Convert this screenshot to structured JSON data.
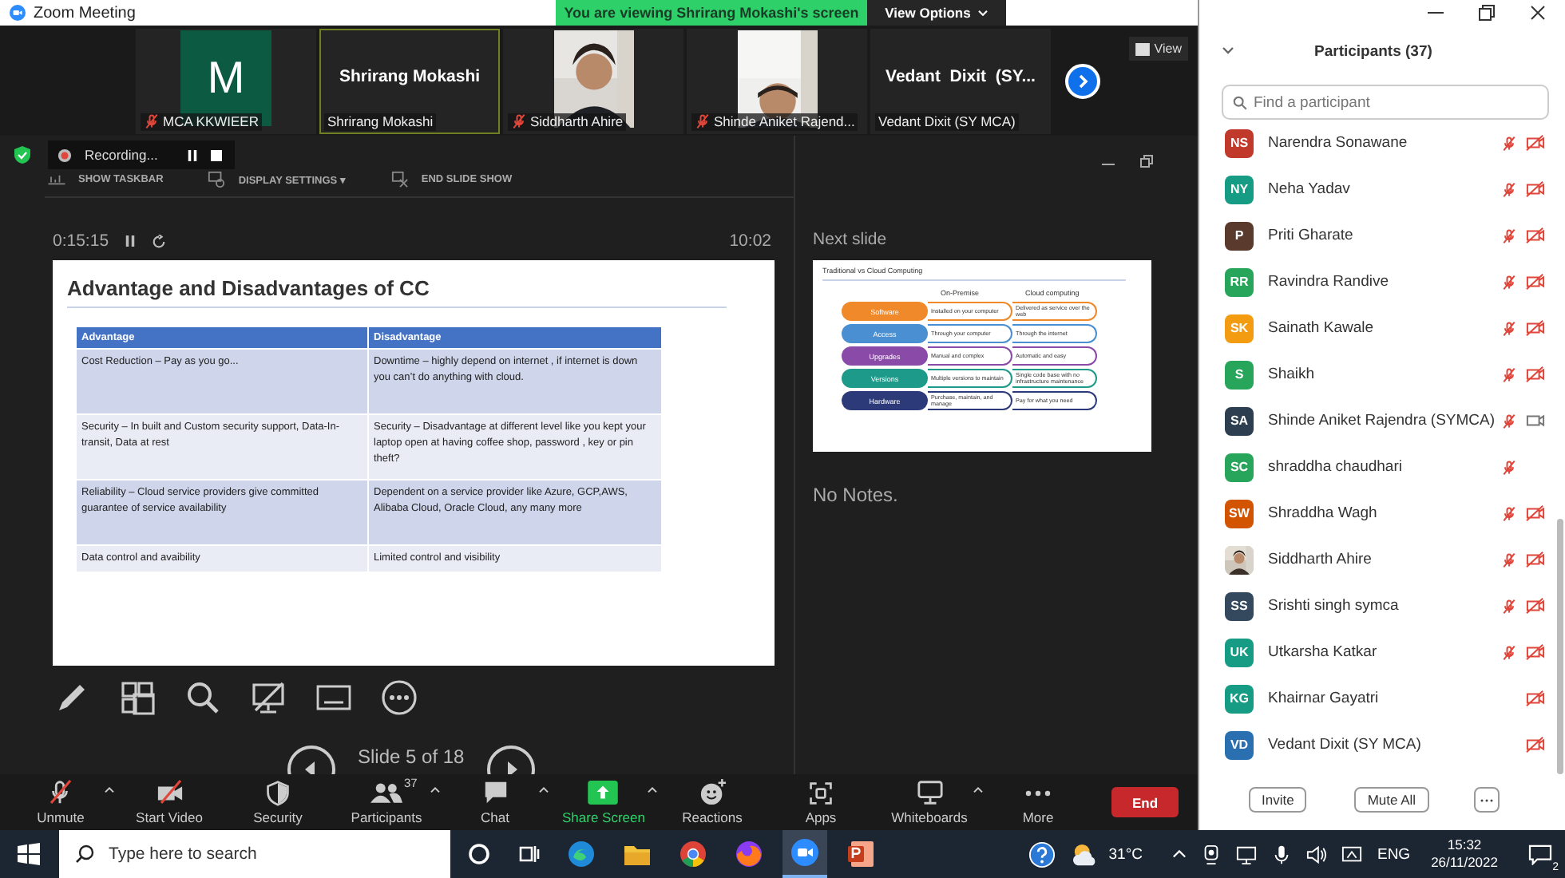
{
  "window": {
    "title": "Zoom Meeting"
  },
  "share_banner": {
    "text": "You are viewing Shrirang Mokashi's screen",
    "options": "View Options"
  },
  "gallery": {
    "tiles": [
      {
        "kind": "initial",
        "letter": "M",
        "name": "MCA KKWIEER",
        "muted": true,
        "selected": false
      },
      {
        "kind": "name",
        "title": "Shrirang Mokashi",
        "name": "Shrirang Mokashi",
        "muted": false,
        "selected": true
      },
      {
        "kind": "picture",
        "name": "Siddharth Ahire",
        "muted": true,
        "selected": false
      },
      {
        "kind": "picture",
        "name": "Shinde Aniket Rajend...",
        "muted": true,
        "selected": false
      },
      {
        "kind": "name",
        "title": "Vedant  Dixit  (SY...",
        "name": "Vedant Dixit (SY MCA)",
        "muted": false,
        "selected": false
      }
    ],
    "view_label": "View"
  },
  "presenter": {
    "recording": "Recording...",
    "menu": [
      "SHOW TASKBAR",
      "DISPLAY SETTINGS ▾",
      "END SLIDE SHOW"
    ],
    "elapsed": "0:15:15",
    "clock": "10:02",
    "slide": {
      "title": "Advantage and Disadvantages of CC",
      "columns": [
        "Advantage",
        "Disadvantage"
      ],
      "rows": [
        [
          "Cost Reduction – Pay as you go...",
          "Downtime – highly depend on internet , if internet is down you can’t do anything with cloud."
        ],
        [
          "Security – In built and Custom security support, Data-In-transit, Data at rest",
          "Security – Disadvantage at different level like you kept your laptop open at having coffee shop, password , key or pin theft?"
        ],
        [
          "Reliability – Cloud service providers give committed guarantee of service availability",
          "Dependent on a service provider like Azure, GCP,AWS, Alibaba Cloud, Oracle Cloud, any many more"
        ],
        [
          "Data control and avaibility",
          "Limited control and visibility"
        ]
      ]
    },
    "next_label": "Next slide",
    "next_slide": {
      "title": "Traditional vs Cloud Computing",
      "columns": [
        "On-Premise",
        "Cloud computing"
      ],
      "rows": [
        {
          "label": "Software",
          "color": "#f0892a",
          "on_premise": "Installed on your computer",
          "cloud": "Delivered as service over the web"
        },
        {
          "label": "Access",
          "color": "#4a8fd1",
          "on_premise": "Through your computer",
          "cloud": "Through the internet"
        },
        {
          "label": "Upgrades",
          "color": "#8a4aa8",
          "on_premise": "Manual and complex",
          "cloud": "Automatic and easy"
        },
        {
          "label": "Versions",
          "color": "#1e9a8a",
          "on_premise": "Multiple versions to maintain",
          "cloud": "Single code base with no infrastructure maintenance"
        },
        {
          "label": "Hardware",
          "color": "#2c3a7a",
          "on_premise": "Purchase, maintain, and manage",
          "cloud": "Pay for what you need"
        }
      ]
    },
    "notes": "No Notes.",
    "slide_counter": "Slide 5 of 18"
  },
  "toolbar": {
    "buttons": [
      {
        "kind": "mic",
        "label": "Unmute",
        "caret": true,
        "slashed": true
      },
      {
        "kind": "video",
        "label": "Start Video",
        "caret": false,
        "slashed": true
      },
      {
        "kind": "security",
        "label": "Security",
        "caret": false,
        "slashed": false
      },
      {
        "kind": "participants",
        "label": "Participants",
        "badge": "37",
        "caret": true,
        "slashed": false
      },
      {
        "kind": "chat",
        "label": "Chat",
        "caret": true,
        "slashed": false
      },
      {
        "kind": "share",
        "label": "Share Screen",
        "caret": true,
        "slashed": false
      },
      {
        "kind": "reactions",
        "label": "Reactions",
        "caret": false,
        "slashed": false
      },
      {
        "kind": "apps",
        "label": "Apps",
        "caret": false,
        "slashed": false
      },
      {
        "kind": "whiteboards",
        "label": "Whiteboards",
        "caret": true,
        "slashed": false
      },
      {
        "kind": "more",
        "label": "More",
        "caret": false,
        "slashed": false
      }
    ],
    "end": "End"
  },
  "participants": {
    "title": "Participants (37)",
    "placeholder": "Find a participant",
    "list": [
      {
        "kind": "initials",
        "initials": "NS",
        "color": "#c0392b",
        "name": "Narendra Sonawane",
        "muted": true,
        "video_off": true,
        "video_on": false
      },
      {
        "kind": "initials",
        "initials": "NY",
        "color": "#169c84",
        "name": "Neha Yadav",
        "muted": true,
        "video_off": true,
        "video_on": false
      },
      {
        "kind": "initials",
        "initials": "P",
        "color": "#5a3a2c",
        "name": "Priti Gharate",
        "muted": true,
        "video_off": true,
        "video_on": false
      },
      {
        "kind": "initials",
        "initials": "RR",
        "color": "#27a55a",
        "name": "Ravindra Randive",
        "muted": true,
        "video_off": true,
        "video_on": false
      },
      {
        "kind": "initials",
        "initials": "SK",
        "color": "#f39c12",
        "name": "Sainath Kawale",
        "muted": true,
        "video_off": true,
        "video_on": false
      },
      {
        "kind": "initials",
        "initials": "S",
        "color": "#27a55a",
        "name": "Shaikh",
        "muted": true,
        "video_off": true,
        "video_on": false
      },
      {
        "kind": "initials",
        "initials": "SA",
        "color": "#2c3e50",
        "name": "Shinde Aniket Rajendra (SYMCA)",
        "muted": true,
        "video_off": false,
        "video_on": true
      },
      {
        "kind": "initials",
        "initials": "SC",
        "color": "#27a55a",
        "name": "shraddha chaudhari",
        "muted": true,
        "video_off": false,
        "video_on": false
      },
      {
        "kind": "initials",
        "initials": "SW",
        "color": "#d35400",
        "name": "Shraddha Wagh",
        "muted": true,
        "video_off": true,
        "video_on": false
      },
      {
        "kind": "picture",
        "name": "Siddharth Ahire",
        "muted": true,
        "video_off": true,
        "video_on": false
      },
      {
        "kind": "initials",
        "initials": "SS",
        "color": "#34495e",
        "name": "Srishti singh symca",
        "muted": true,
        "video_off": true,
        "video_on": false
      },
      {
        "kind": "initials",
        "initials": "UK",
        "color": "#169c84",
        "name": "Utkarsha Katkar",
        "muted": true,
        "video_off": true,
        "video_on": false
      },
      {
        "kind": "initials",
        "initials": "KG",
        "color": "#169c84",
        "name": "Khairnar Gayatri",
        "muted": false,
        "video_off": true,
        "video_on": false
      },
      {
        "kind": "initials",
        "initials": "VD",
        "color": "#2a6fb0",
        "name": "Vedant Dixit (SY MCA)",
        "muted": false,
        "video_off": true,
        "video_on": false
      }
    ],
    "buttons": [
      "Invite",
      "Mute All"
    ]
  },
  "taskbar": {
    "placeholder": "Type here to search",
    "temperature": "31°C",
    "language": "ENG",
    "time": "15:32",
    "date": "26/11/2022",
    "notifications": "2"
  }
}
